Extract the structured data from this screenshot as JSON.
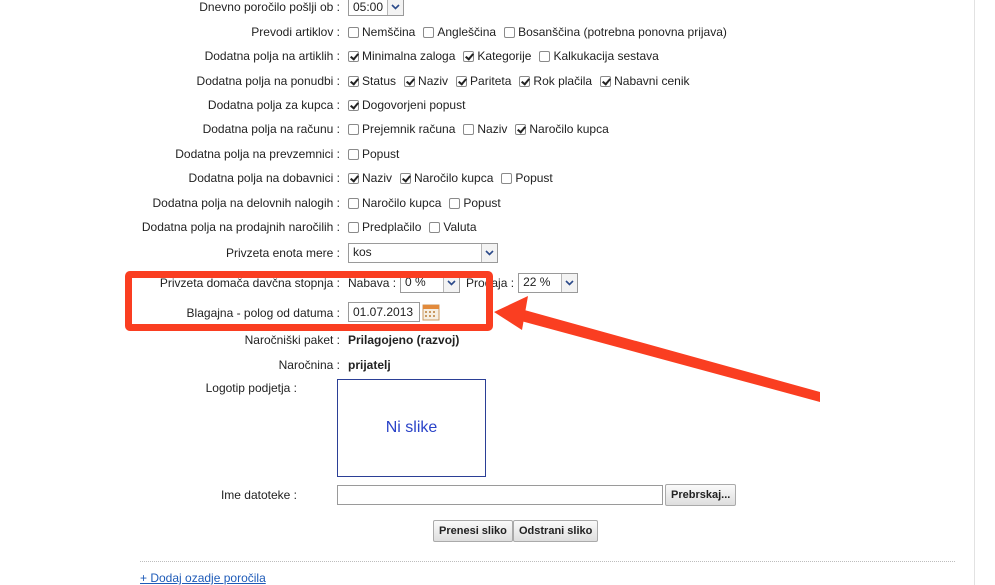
{
  "colors": {
    "highlight": "#fa3e21",
    "link": "#1e5bb8",
    "placeholder_text": "#2a43c8"
  },
  "daily_report": {
    "label": "Dnevno poročilo pošlji ob :",
    "value": "05:00"
  },
  "translations": {
    "label": "Prevodi artiklov :",
    "options": [
      {
        "label": "Nemščina",
        "checked": false
      },
      {
        "label": "Angleščina",
        "checked": false
      },
      {
        "label": "Bosanščina (potrebna ponovna prijava)",
        "checked": false
      }
    ]
  },
  "article_fields": {
    "label": "Dodatna polja na artiklih :",
    "options": [
      {
        "label": "Minimalna zaloga",
        "checked": true
      },
      {
        "label": "Kategorije",
        "checked": true
      },
      {
        "label": "Kalkukacija sestava",
        "checked": false
      }
    ]
  },
  "offer_fields": {
    "label": "Dodatna polja na ponudbi :",
    "options": [
      {
        "label": "Status",
        "checked": true
      },
      {
        "label": "Naziv",
        "checked": true
      },
      {
        "label": "Pariteta",
        "checked": true
      },
      {
        "label": "Rok plačila",
        "checked": true
      },
      {
        "label": "Nabavni cenik",
        "checked": true
      }
    ]
  },
  "customer_fields": {
    "label": "Dodatna polja za kupca :",
    "options": [
      {
        "label": "Dogovorjeni popust",
        "checked": true
      }
    ]
  },
  "invoice_fields": {
    "label": "Dodatna polja na računu :",
    "options": [
      {
        "label": "Prejemnik računa",
        "checked": false
      },
      {
        "label": "Naziv",
        "checked": false
      },
      {
        "label": "Naročilo kupca",
        "checked": true
      }
    ]
  },
  "delivery_fields": {
    "label": "Dodatna polja na prevzemnici :",
    "options": [
      {
        "label": "Popust",
        "checked": false
      }
    ]
  },
  "dispatch_fields": {
    "label": "Dodatna polja na dobavnici :",
    "options": [
      {
        "label": "Naziv",
        "checked": true
      },
      {
        "label": "Naročilo kupca",
        "checked": true
      },
      {
        "label": "Popust",
        "checked": false
      }
    ]
  },
  "workorder_fields": {
    "label": "Dodatna polja na delovnih nalogih :",
    "options": [
      {
        "label": "Naročilo kupca",
        "checked": false
      },
      {
        "label": "Popust",
        "checked": false
      }
    ]
  },
  "salesorder_fields": {
    "label": "Dodatna polja na prodajnih naročilih :",
    "options": [
      {
        "label": "Predplačilo",
        "checked": false
      },
      {
        "label": "Valuta",
        "checked": false
      }
    ]
  },
  "unit": {
    "label": "Privzeta enota mere :",
    "value": "kos"
  },
  "tax": {
    "label": "Privzeta domača davčna stopnja :",
    "purchase_label": "Nabava :",
    "purchase_value": "0 %",
    "sale_label": "Prodaja :",
    "sale_value": "22 %"
  },
  "cash": {
    "label": "Blagajna - polog od datuma :",
    "value": "01.07.2013"
  },
  "subscription_pkg": {
    "label": "Naročniški paket :",
    "value": "Prilagojeno (razvoj)"
  },
  "subscription": {
    "label": "Naročnina :",
    "value": "prijatelj"
  },
  "logo": {
    "label": "Logotip podjetja :",
    "empty_text": "Ni slike"
  },
  "file": {
    "label": "Ime datoteke :",
    "value": "",
    "browse_label": "Prebrskaj..."
  },
  "buttons": {
    "upload": "Prenesi sliko",
    "remove": "Odstrani sliko"
  },
  "footer_link": "+ Dodaj ozadje poročila"
}
